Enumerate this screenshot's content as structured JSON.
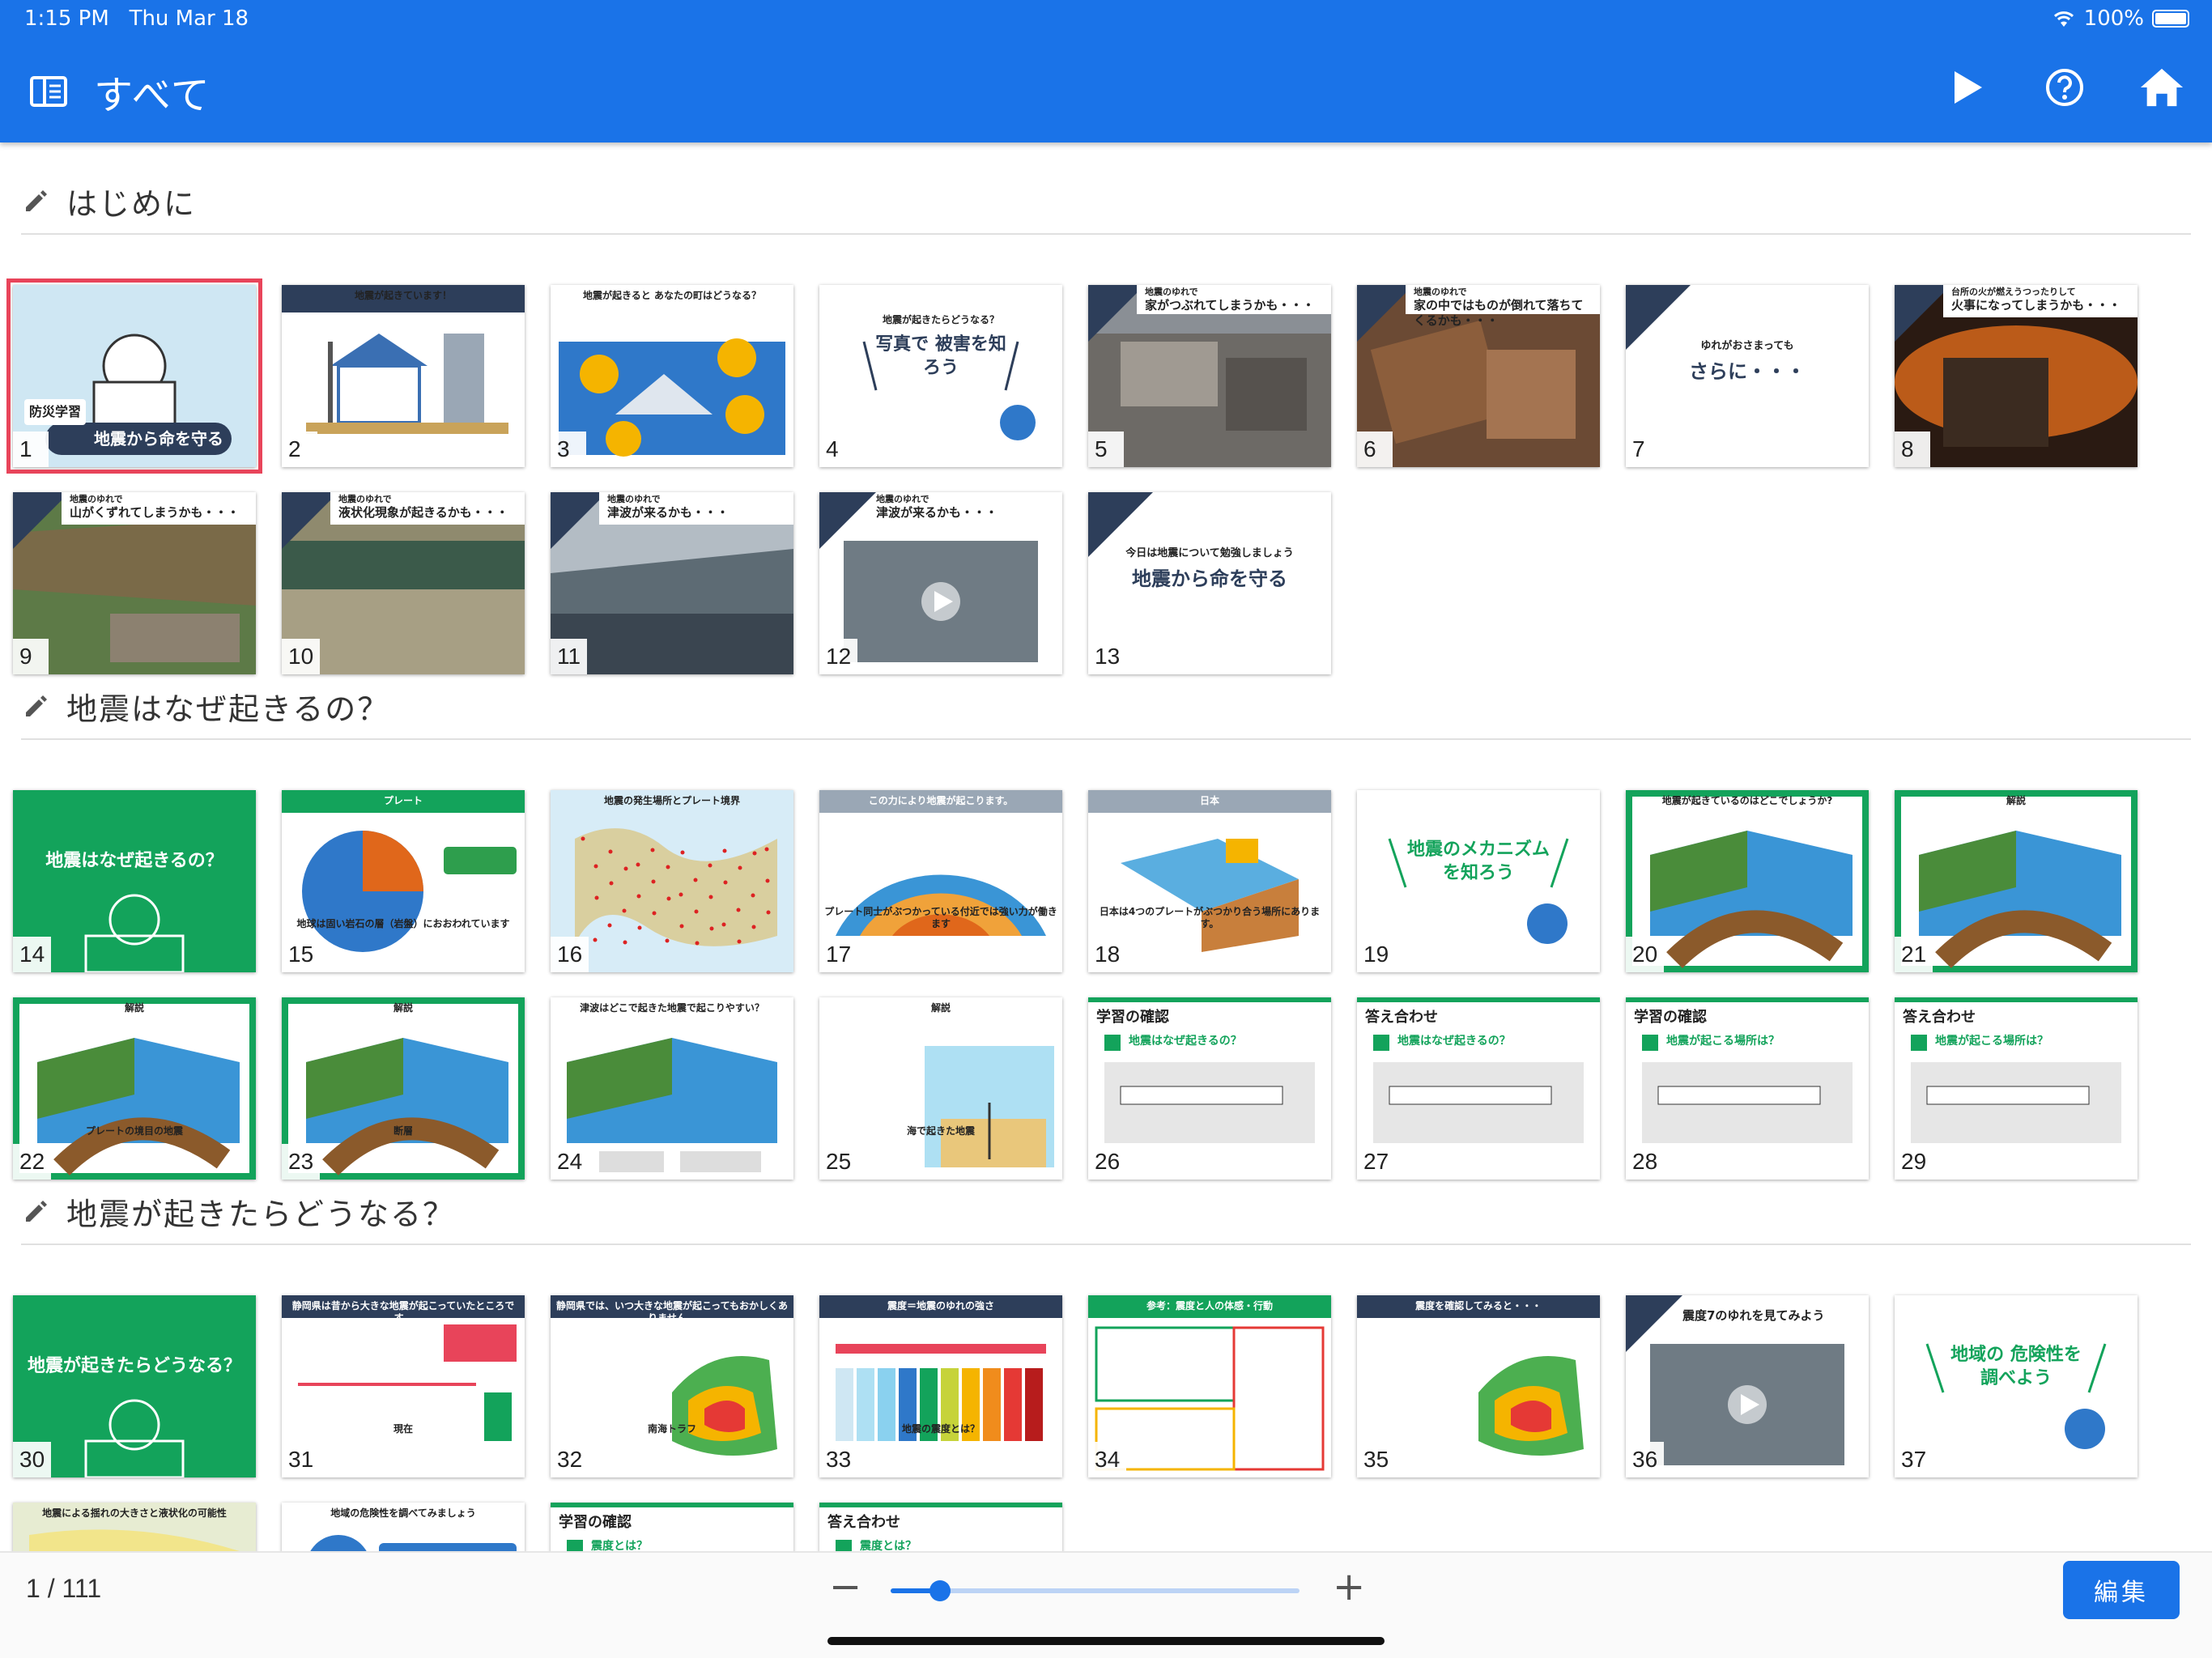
{
  "status_bar": {
    "time": "1:15 PM",
    "date": "Thu Mar 18",
    "battery": "100%"
  },
  "app_bar": {
    "title": "すべて",
    "icons": [
      "sidebar-icon",
      "play-icon",
      "help-icon",
      "home-icon"
    ]
  },
  "sections": [
    {
      "title": "はじめに",
      "slides": [
        {
          "n": "1",
          "text": "地震から命を守る",
          "sub": "防災学習",
          "kind": "cover",
          "selected": true
        },
        {
          "n": "2",
          "text": "地震が起きています！",
          "kind": "house"
        },
        {
          "n": "3",
          "text": "地震が起きると あなたの町はどうなる？",
          "kind": "question"
        },
        {
          "n": "4",
          "text": "写真で 被害を知ろう",
          "sub": "地震が起きたらどうなる？",
          "kind": "title-white"
        },
        {
          "n": "5",
          "text": "家がつぶれてしまうかも・・・",
          "sub": "地震のゆれで",
          "kind": "photo-gray"
        },
        {
          "n": "6",
          "text": "家の中ではものが倒れて落ちてくるかも・・・",
          "sub": "地震のゆれで",
          "kind": "photo-brown"
        },
        {
          "n": "7",
          "text": "さらに・・・",
          "sub": "ゆれがおさまっても",
          "kind": "text-white"
        },
        {
          "n": "8",
          "text": "火事になってしまうかも・・・",
          "sub": "台所の火が燃えうつったりして",
          "kind": "photo-fire"
        },
        {
          "n": "9",
          "text": "山がくずれてしまうかも・・・",
          "sub": "地震のゆれで",
          "kind": "photo-green"
        },
        {
          "n": "10",
          "text": "液状化現象が起きるかも・・・",
          "sub": "地震のゆれで",
          "kind": "photo-mud"
        },
        {
          "n": "11",
          "text": "津波が来るかも・・・",
          "sub": "地震のゆれで",
          "kind": "photo-sea"
        },
        {
          "n": "12",
          "text": "津波が来るかも・・・",
          "sub": "地震のゆれで",
          "kind": "photo-video"
        },
        {
          "n": "13",
          "text": "地震から命を守る",
          "sub": "今日は地震について勉強しましょう",
          "kind": "text-white"
        }
      ]
    },
    {
      "title": "地震はなぜ起きるの？",
      "slides": [
        {
          "n": "14",
          "text": "地震はなぜ起きるの？",
          "kind": "green-title"
        },
        {
          "n": "15",
          "text": "プレート",
          "sub": "地球は固い岩石の層（岩盤）におおわれています",
          "kind": "earth"
        },
        {
          "n": "16",
          "text": "地震の発生場所とプレート境界",
          "kind": "map-world"
        },
        {
          "n": "17",
          "text": "この力により地震が起こります。",
          "sub": "プレート同士がぶつかっている付近では強い力が働きます",
          "kind": "diagram-plate"
        },
        {
          "n": "18",
          "text": "日本",
          "sub": "日本は4つのプレートがぶつかり合う場所にあります。",
          "kind": "diagram-japan"
        },
        {
          "n": "19",
          "text": "地震のメカニズム を知ろう",
          "kind": "title-green-text"
        },
        {
          "n": "20",
          "text": "地震が起きているのはどこでしょうか?",
          "kind": "diagram-green"
        },
        {
          "n": "21",
          "text": "解説",
          "kind": "diagram-green"
        },
        {
          "n": "22",
          "text": "解説",
          "sub": "プレートの境目の地震",
          "kind": "diagram-green"
        },
        {
          "n": "23",
          "text": "解説",
          "sub": "断層",
          "kind": "diagram-green"
        },
        {
          "n": "24",
          "text": "津波はどこで起きた地震で起こりやすい？",
          "kind": "diagram-tsunami"
        },
        {
          "n": "25",
          "text": "解説",
          "sub": "海で起きた地震",
          "kind": "diagram-tsunami2"
        },
        {
          "n": "26",
          "text": "学習の確認",
          "sub": "地震はなぜ起きるの？",
          "kind": "quiz"
        },
        {
          "n": "27",
          "text": "答え合わせ",
          "sub": "地震はなぜ起きるの？",
          "kind": "quiz"
        },
        {
          "n": "28",
          "text": "学習の確認",
          "sub": "地震が起こる場所は？",
          "kind": "quiz"
        },
        {
          "n": "29",
          "text": "答え合わせ",
          "sub": "地震が起こる場所は？",
          "kind": "quiz"
        }
      ]
    },
    {
      "title": "地震が起きたらどうなる？",
      "slides": [
        {
          "n": "30",
          "text": "地震が起きたらどうなる？",
          "kind": "green-title"
        },
        {
          "n": "31",
          "text": "静岡県は昔から大きな地震が起こっていたところです。",
          "sub": "現在",
          "kind": "timeline"
        },
        {
          "n": "32",
          "text": "静岡県では、いつ大きな地震が起こってもおかしくありません。",
          "sub": "南海トラフ",
          "kind": "map-shizuoka"
        },
        {
          "n": "33",
          "text": "震度＝地震のゆれの強さ",
          "sub": "地震の震度とは？",
          "kind": "scale"
        },
        {
          "n": "34",
          "text": "参考：震度と人の体感・行動",
          "kind": "illustration"
        },
        {
          "n": "35",
          "text": "震度を確認してみると・・・",
          "kind": "map-shizuoka"
        },
        {
          "n": "36",
          "text": "震度7のゆれを見てみよう",
          "kind": "photo-video"
        },
        {
          "n": "37",
          "text": "地域の 危険性を調べよう",
          "kind": "title-green-text"
        },
        {
          "n": "38",
          "text": "地震による揺れの大きさと液状化の可能性",
          "kind": "map-partial"
        },
        {
          "n": "39",
          "text": "地域の危険性を調べてみましょう",
          "kind": "char-partial"
        },
        {
          "n": "40",
          "text": "学習の確認",
          "sub": "震度とは？",
          "kind": "quiz"
        },
        {
          "n": "41",
          "text": "答え合わせ",
          "sub": "震度とは？",
          "kind": "quiz"
        }
      ]
    }
  ],
  "footer": {
    "page_counter": "1 / 111",
    "zoom_minus": "−",
    "zoom_plus": "+",
    "zoom_level": 0.12,
    "edit_label": "編集"
  },
  "colors": {
    "primary": "#1a73e8",
    "green": "#13a35b",
    "navy": "#2d3e5a",
    "selection": "#e8445a"
  }
}
